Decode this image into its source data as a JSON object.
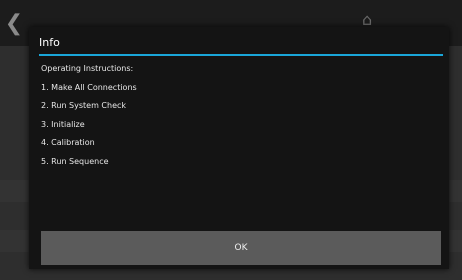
{
  "dialog": {
    "title": "Info",
    "heading": "Operating Instructions:",
    "steps": [
      "1. Make All Connections",
      "2. Run System Check",
      "3. Initialize",
      "4. Calibration",
      "5. Run Sequence"
    ],
    "ok_label": "OK"
  },
  "colors": {
    "accent": "#1aa6d9",
    "dialog_bg": "#141414",
    "button_bg": "#5b5b5b"
  }
}
